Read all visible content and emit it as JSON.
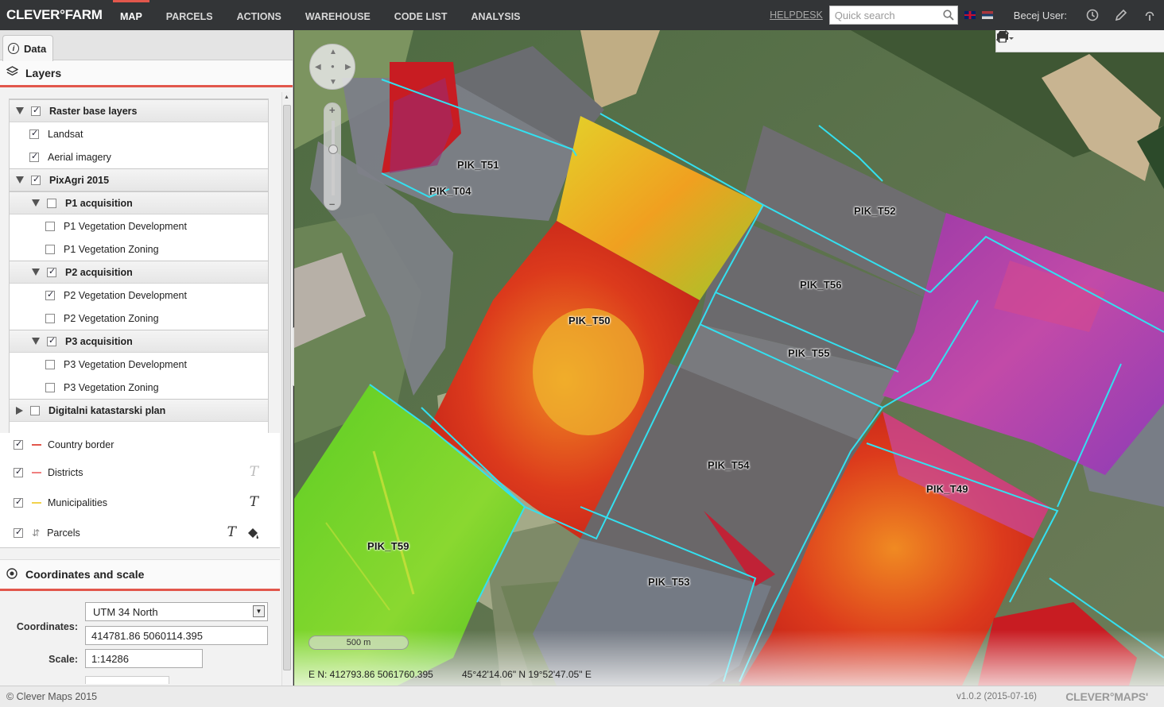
{
  "app": {
    "logo": "CLEVER°FARM",
    "user_label": "Becej User:"
  },
  "nav": [
    {
      "label": "MAP",
      "active": true
    },
    {
      "label": "PARCELS"
    },
    {
      "label": "ACTIONS"
    },
    {
      "label": "WAREHOUSE"
    },
    {
      "label": "CODE LIST"
    },
    {
      "label": "ANALYSIS"
    }
  ],
  "header": {
    "helpdesk": "HELPDESK",
    "search_placeholder": "Quick search",
    "icons": [
      "clock-icon",
      "pencil-icon",
      "signal-icon"
    ]
  },
  "sidebar": {
    "tab": "Data",
    "layers_title": "Layers",
    "groups": {
      "raster": {
        "label": "Raster base layers",
        "checked": true
      },
      "landsat": {
        "label": "Landsat",
        "checked": true
      },
      "aerial": {
        "label": "Aerial imagery",
        "checked": true
      },
      "pixagri": {
        "label": "PixAgri 2015",
        "checked": true
      },
      "p1": {
        "label": "P1 acquisition",
        "checked": false
      },
      "p1_dev": {
        "label": "P1 Vegetation Development",
        "checked": false
      },
      "p1_zone": {
        "label": "P1 Vegetation Zoning",
        "checked": false
      },
      "p2": {
        "label": "P2 acquisition",
        "checked": true
      },
      "p2_dev": {
        "label": "P2 Vegetation Development",
        "checked": true
      },
      "p2_zone": {
        "label": "P2 Vegetation Zoning",
        "checked": false
      },
      "p3": {
        "label": "P3 acquisition",
        "checked": true
      },
      "p3_dev": {
        "label": "P3 Vegetation Development",
        "checked": false
      },
      "p3_zone": {
        "label": "P3 Vegetation Zoning",
        "checked": false
      },
      "dkp": {
        "label": "Digitalni katastarski plan",
        "checked": false
      },
      "country": {
        "label": "Country border",
        "checked": true,
        "color": "#e2574c"
      },
      "districts": {
        "label": "Districts",
        "checked": true,
        "color": "#f08080"
      },
      "municipalities": {
        "label": "Municipalities",
        "checked": true,
        "color": "#f2d24c"
      },
      "parcels": {
        "label": "Parcels",
        "checked": true
      }
    },
    "coords_title": "Coordinates and scale",
    "coordinates_label": "Coordinates:",
    "projection": "UTM 34 North",
    "coordinates_value": "414781.86 5060114.395",
    "scale_label": "Scale:",
    "scale_value": "1:14286"
  },
  "map": {
    "scale_bar": "500 m",
    "readout_en": "E N: 412793.86 5061760.395",
    "readout_latlon": "45°42'14.06\" N 19°52'47.05\" E",
    "parcels": [
      "PIK_T51",
      "PIK_T04",
      "PIK_T52",
      "PIK_T56",
      "PIK_T50",
      "PIK_T55",
      "PIK_T54",
      "PIK_T49",
      "PIK_T59",
      "PIK_T53"
    ],
    "colors": {
      "boundary": "#33e0f0",
      "high": "#d0261d",
      "mid": "#f2c21c",
      "low": "#5fd22a",
      "bare": "#6f6c6e",
      "purple": "#a040b0"
    }
  },
  "footer": {
    "copyright": "© Clever Maps 2015",
    "version": "v1.0.2 (2015-07-16)",
    "brand": "CLEVER°MAPS'"
  }
}
